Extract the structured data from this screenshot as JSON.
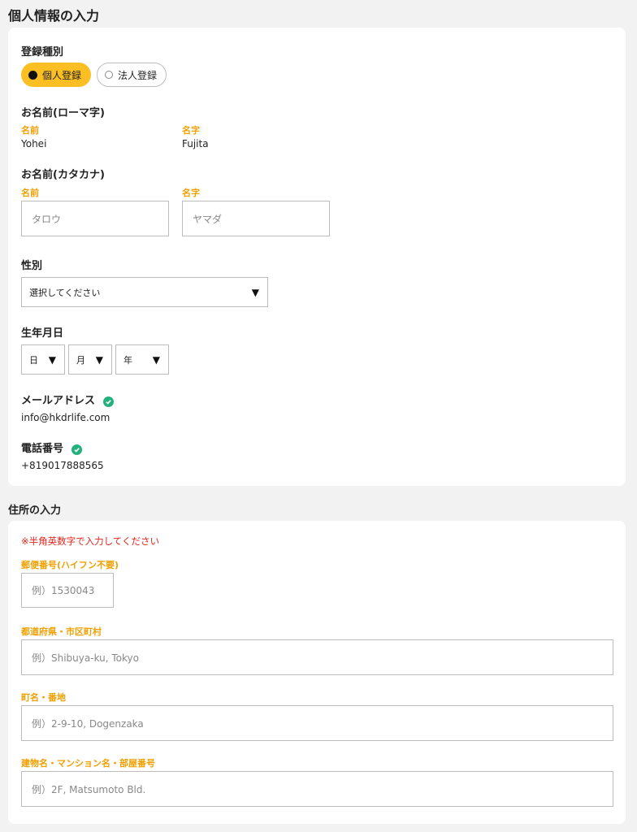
{
  "personal": {
    "title": "個人情報の入力",
    "reg_type": {
      "label": "登録種別",
      "options": [
        "個人登録",
        "法人登録"
      ],
      "selected": "個人登録"
    },
    "romaji": {
      "label": "お名前(ローマ字)",
      "first_label": "名前",
      "first_value": "Yohei",
      "last_label": "名字",
      "last_value": "Fujita"
    },
    "katakana": {
      "label": "お名前(カタカナ)",
      "first_label": "名前",
      "first_placeholder": "タロウ",
      "last_label": "名字",
      "last_placeholder": "ヤマダ"
    },
    "gender": {
      "label": "性別",
      "selected": "選択してください"
    },
    "birthday": {
      "label": "生年月日",
      "day": "日",
      "month": "月",
      "year": "年"
    },
    "email": {
      "label": "メールアドレス",
      "value": "info@hkdrlife.com"
    },
    "phone": {
      "label": "電話番号",
      "value": "+819017888565"
    }
  },
  "address": {
    "title": "住所の入力",
    "note": "※半角英数字で入力してください",
    "postal": {
      "label": "郵便番号(ハイフン不要)",
      "placeholder": "例）1530043"
    },
    "city": {
      "label": "都道府県・市区町村",
      "placeholder": "例）Shibuya-ku, Tokyo"
    },
    "street": {
      "label": "町名・番地",
      "placeholder": "例）2-9-10, Dogenzaka"
    },
    "building": {
      "label": "建物名・マンション名・部屋番号",
      "placeholder": "例）2F, Matsumoto Bld."
    }
  },
  "colors": {
    "accent": "#fbbf24",
    "sublabel": "#f0a000",
    "verified": "#22b07d",
    "note": "#e0231a"
  }
}
